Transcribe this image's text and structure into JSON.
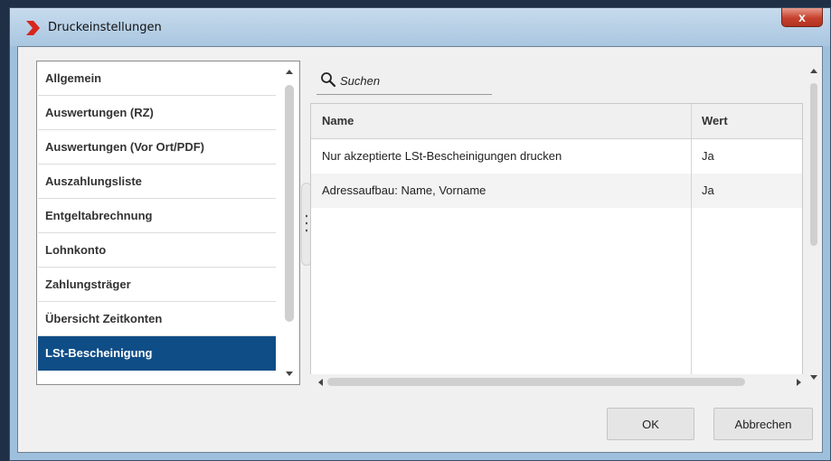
{
  "window": {
    "title": "Druckeinstellungen",
    "close_label": "x",
    "accent": "#d7261e"
  },
  "categories": {
    "items": [
      {
        "label": "Allgemein"
      },
      {
        "label": "Auswertungen (RZ)"
      },
      {
        "label": "Auswertungen (Vor Ort/PDF)"
      },
      {
        "label": "Auszahlungsliste"
      },
      {
        "label": "Entgeltabrechnung"
      },
      {
        "label": "Lohnkonto"
      },
      {
        "label": "Zahlungsträger"
      },
      {
        "label": "Übersicht Zeitkonten"
      },
      {
        "label": "LSt-Bescheinigung"
      }
    ],
    "selected": "LSt-Bescheinigung",
    "selected_color": "#0f4d86"
  },
  "search": {
    "placeholder": "Suchen",
    "value": ""
  },
  "table": {
    "columns": [
      "Name",
      "Wert"
    ],
    "rows": [
      {
        "name": "Nur akzeptierte LSt-Bescheinigungen drucken",
        "wert": "Ja"
      },
      {
        "name": "Adressaufbau: Name, Vorname",
        "wert": "Ja"
      }
    ]
  },
  "buttons": {
    "ok": "OK",
    "cancel": "Abbrechen"
  }
}
